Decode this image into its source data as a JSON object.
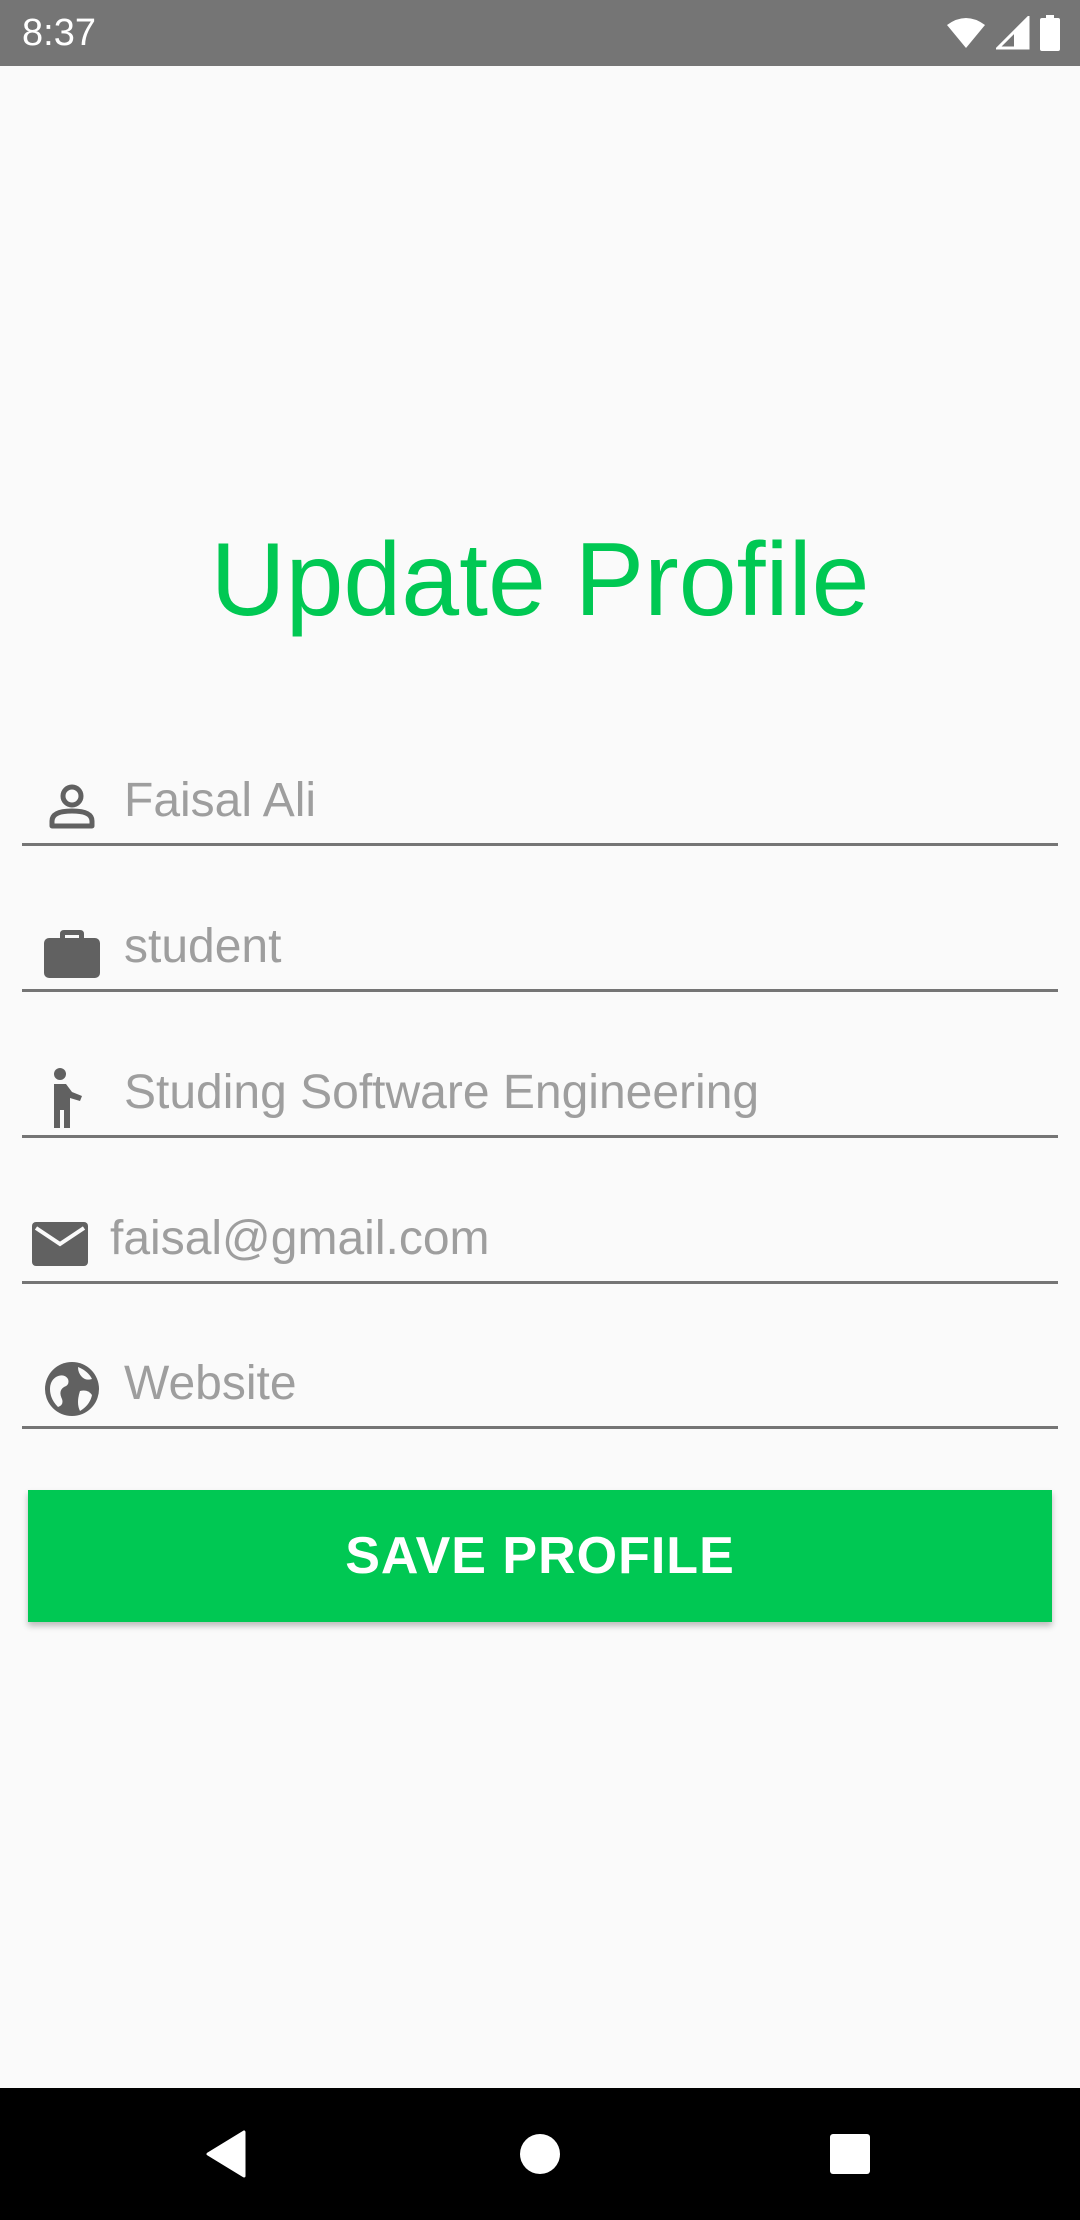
{
  "status_bar": {
    "time": "8:37",
    "icons": [
      "wifi-icon",
      "signal-icon",
      "battery-icon"
    ]
  },
  "page": {
    "title": "Update Profile"
  },
  "form": {
    "fields": [
      {
        "icon": "person-icon",
        "value": "",
        "placeholder": "Faisal Ali"
      },
      {
        "icon": "briefcase-icon",
        "value": "",
        "placeholder": "student"
      },
      {
        "icon": "person-pin-icon",
        "value": "",
        "placeholder": "Studing Software Engineering"
      },
      {
        "icon": "email-icon",
        "value": "",
        "placeholder": "faisal@gmail.com"
      },
      {
        "icon": "globe-icon",
        "value": "",
        "placeholder": "Website"
      }
    ],
    "save_label": "SAVE PROFILE"
  },
  "nav_bar": {
    "buttons": [
      "back-icon",
      "home-icon",
      "recents-icon"
    ]
  },
  "colors": {
    "accent": "#00c853",
    "status_bar": "#757575",
    "icon": "#616161",
    "placeholder": "#9e9e9e",
    "underline": "#757575",
    "nav_bar": "#000000"
  }
}
